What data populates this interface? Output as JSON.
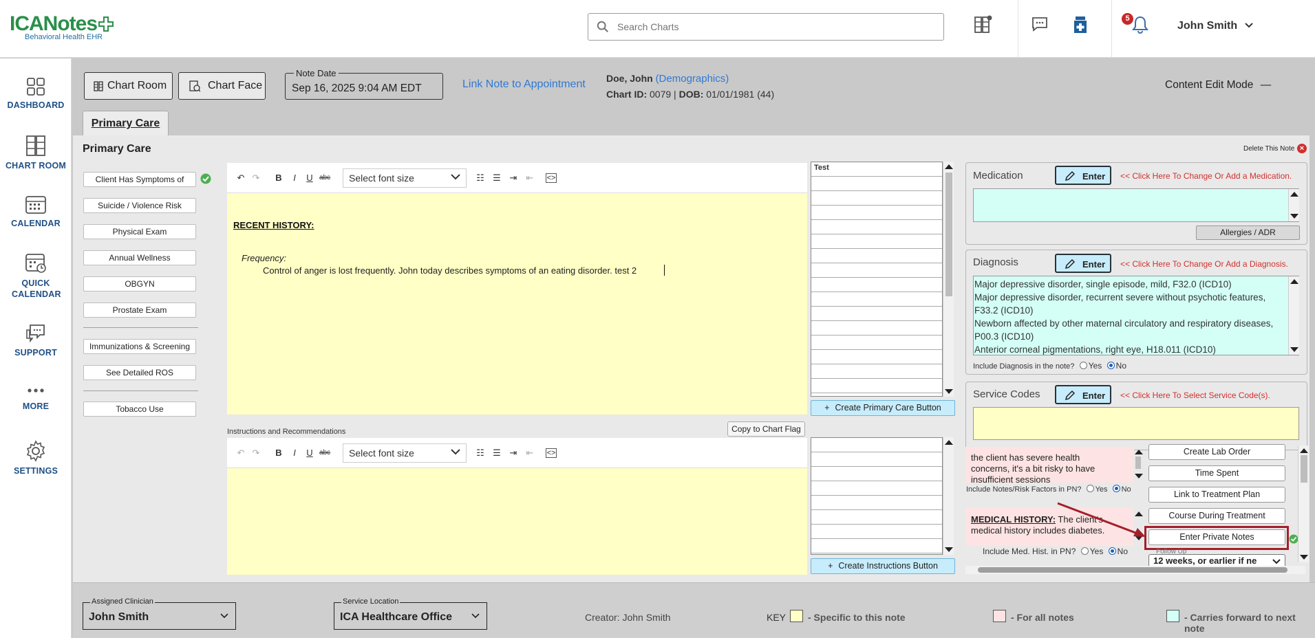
{
  "app": {
    "logo_text": "ICANotes",
    "logo_sub": "Behavioral Health EHR"
  },
  "search": {
    "placeholder": "Search Charts"
  },
  "notifications": {
    "count": "5"
  },
  "user": {
    "name": "John Smith"
  },
  "nav": [
    {
      "label": "DASHBOARD",
      "icon": "dashboard-icon"
    },
    {
      "label": "CHART ROOM",
      "icon": "chart-room-icon"
    },
    {
      "label": "CALENDAR",
      "icon": "calendar-icon"
    },
    {
      "label": "QUICK CALENDAR",
      "icon": "quick-calendar-icon"
    },
    {
      "label": "SUPPORT",
      "icon": "support-icon"
    },
    {
      "label": "MORE",
      "icon": "more-icon"
    },
    {
      "label": "SETTINGS",
      "icon": "settings-icon"
    }
  ],
  "header": {
    "chart_room": "Chart Room",
    "chart_face": "Chart Face",
    "note_date_label": "Note Date",
    "note_date_value": "Sep 16, 2025 9:04 AM EDT",
    "link_note": "Link Note to Appointment",
    "patient_name": "Doe, John",
    "demographics": "(Demographics)",
    "chart_id_label": "Chart ID:",
    "chart_id": "0079",
    "dob_label": "DOB:",
    "dob": "01/01/1981 (44)",
    "content_mode": "Content Edit Mode"
  },
  "tab": {
    "label": "Primary Care"
  },
  "panel": {
    "title": "Primary Care",
    "delete_note": "Delete This Note"
  },
  "left_buttons": [
    "Client Has Symptoms of",
    "Suicide / Violence Risk",
    "Physical Exam",
    "Annual Wellness",
    "OBGYN",
    "Prostate Exam",
    "Immunizations & Screening",
    "See Detailed ROS",
    "Tobacco Use"
  ],
  "editor": {
    "font_size": "Select font size",
    "recent_history": "RECENT HISTORY:",
    "frequency": "Frequency:",
    "frequency_text": "Control of anger is lost frequently. John today describes symptoms of an eating disorder. test 2",
    "instructions_label": "Instructions and Recommendations",
    "copy_flag": "Copy to Chart Flag"
  },
  "side_grid": {
    "header": "Test"
  },
  "create_buttons": {
    "primary": "Create Primary Care Button",
    "instructions": "Create Instructions Button"
  },
  "medication": {
    "title": "Medication",
    "enter": "Enter",
    "hint": "<< Click Here To Change Or Add a Medication.",
    "allergies": "Allergies / ADR"
  },
  "diagnosis": {
    "title": "Diagnosis",
    "enter": "Enter",
    "hint": "<< Click Here To Change Or Add a Diagnosis.",
    "items": [
      "Major depressive disorder, single episode, mild, F32.0 (ICD10)",
      "Major depressive disorder, recurrent severe without psychotic features, F33.2 (ICD10)",
      "Newborn affected by other maternal circulatory and respiratory diseases, P00.3 (ICD10)",
      "Anterior corneal pigmentations, right eye, H18.011 (ICD10)"
    ],
    "include_label": "Include Diagnosis in the note?",
    "yes": "Yes",
    "no": "No"
  },
  "service_codes": {
    "title": "Service Codes",
    "enter": "Enter",
    "hint": "<< Click Here To Select Service Code(s)."
  },
  "notes_risk": {
    "text": "the client has severe health concerns, it's a bit risky to have insufficient sessions",
    "include_label": "Include Notes/Risk Factors in PN?",
    "yes": "Yes",
    "no": "No"
  },
  "med_history": {
    "label": "MEDICAL HISTORY:",
    "text": "The client's medical history includes diabetes.",
    "include_label": "Include Med. Hist. in PN?",
    "yes": "Yes",
    "no": "No"
  },
  "actions": [
    "Create Lab Order",
    "Time Spent",
    "Link to Treatment Plan",
    "Course During Treatment",
    "Enter Private Notes"
  ],
  "follow_up": {
    "label": "Follow Up",
    "value": "12 weeks, or earlier if ne"
  },
  "footer": {
    "clinician_label": "Assigned Clinician",
    "clinician": "John Smith",
    "location_label": "Service Location",
    "location": "ICA Healthcare Office",
    "creator": "Creator: John Smith",
    "key": "KEY",
    "key_yellow": "- Specific to this note",
    "key_pink": "- For all notes",
    "key_cyan": "- Carries forward to next note"
  },
  "colors": {
    "accent": "#1e4f86",
    "link": "#2f79d3",
    "note_yellow": "#ffffc6",
    "pink": "#fde3e3",
    "cyan": "#d4fff6",
    "highlight": "#a31f2a"
  }
}
